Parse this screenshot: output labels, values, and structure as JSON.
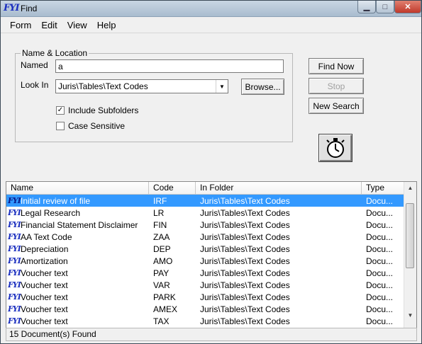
{
  "window": {
    "app_icon": "FYI",
    "title": "Find",
    "minimize": "▁",
    "maximize": "□",
    "close": "✕"
  },
  "menu": [
    "Form",
    "Edit",
    "View",
    "Help"
  ],
  "group": {
    "legend": "Name & Location",
    "named_label": "Named",
    "named_value": "a",
    "look_in_label": "Look In",
    "look_in_value": "Juris\\Tables\\Text Codes",
    "browse_label": "Browse...",
    "include_subfolders_label": "Include Subfolders",
    "include_subfolders_checked": true,
    "case_sensitive_label": "Case Sensitive",
    "case_sensitive_checked": false
  },
  "buttons": {
    "find_now": "Find Now",
    "stop": "Stop",
    "new_search": "New Search"
  },
  "timer_icon": "stopwatch-icon",
  "list": {
    "columns": [
      "Name",
      "Code",
      "In Folder",
      "Type"
    ],
    "rows": [
      {
        "name": "Initial review of file",
        "code": "IRF",
        "folder": "Juris\\Tables\\Text Codes",
        "type": "Docu...",
        "selected": true
      },
      {
        "name": "Legal Research",
        "code": "LR",
        "folder": "Juris\\Tables\\Text Codes",
        "type": "Docu..."
      },
      {
        "name": "Financial Statement Disclaimer",
        "code": "FIN",
        "folder": "Juris\\Tables\\Text Codes",
        "type": "Docu..."
      },
      {
        "name": "AA Text Code",
        "code": "ZAA",
        "folder": "Juris\\Tables\\Text Codes",
        "type": "Docu..."
      },
      {
        "name": "Depreciation",
        "code": "DEP",
        "folder": "Juris\\Tables\\Text Codes",
        "type": "Docu..."
      },
      {
        "name": "Amortization",
        "code": "AMO",
        "folder": "Juris\\Tables\\Text Codes",
        "type": "Docu..."
      },
      {
        "name": "Voucher text",
        "code": "PAY",
        "folder": "Juris\\Tables\\Text Codes",
        "type": "Docu..."
      },
      {
        "name": "Voucher text",
        "code": "VAR",
        "folder": "Juris\\Tables\\Text Codes",
        "type": "Docu..."
      },
      {
        "name": "Voucher text",
        "code": "PARK",
        "folder": "Juris\\Tables\\Text Codes",
        "type": "Docu..."
      },
      {
        "name": "Voucher text",
        "code": "AMEX",
        "folder": "Juris\\Tables\\Text Codes",
        "type": "Docu..."
      },
      {
        "name": "Voucher text",
        "code": "TAX",
        "folder": "Juris\\Tables\\Text Codes",
        "type": "Docu..."
      }
    ]
  },
  "status": "15 Document(s) Found",
  "colors": {
    "selection": "#3399ff",
    "fyi_icon": "#1b2fbf"
  }
}
